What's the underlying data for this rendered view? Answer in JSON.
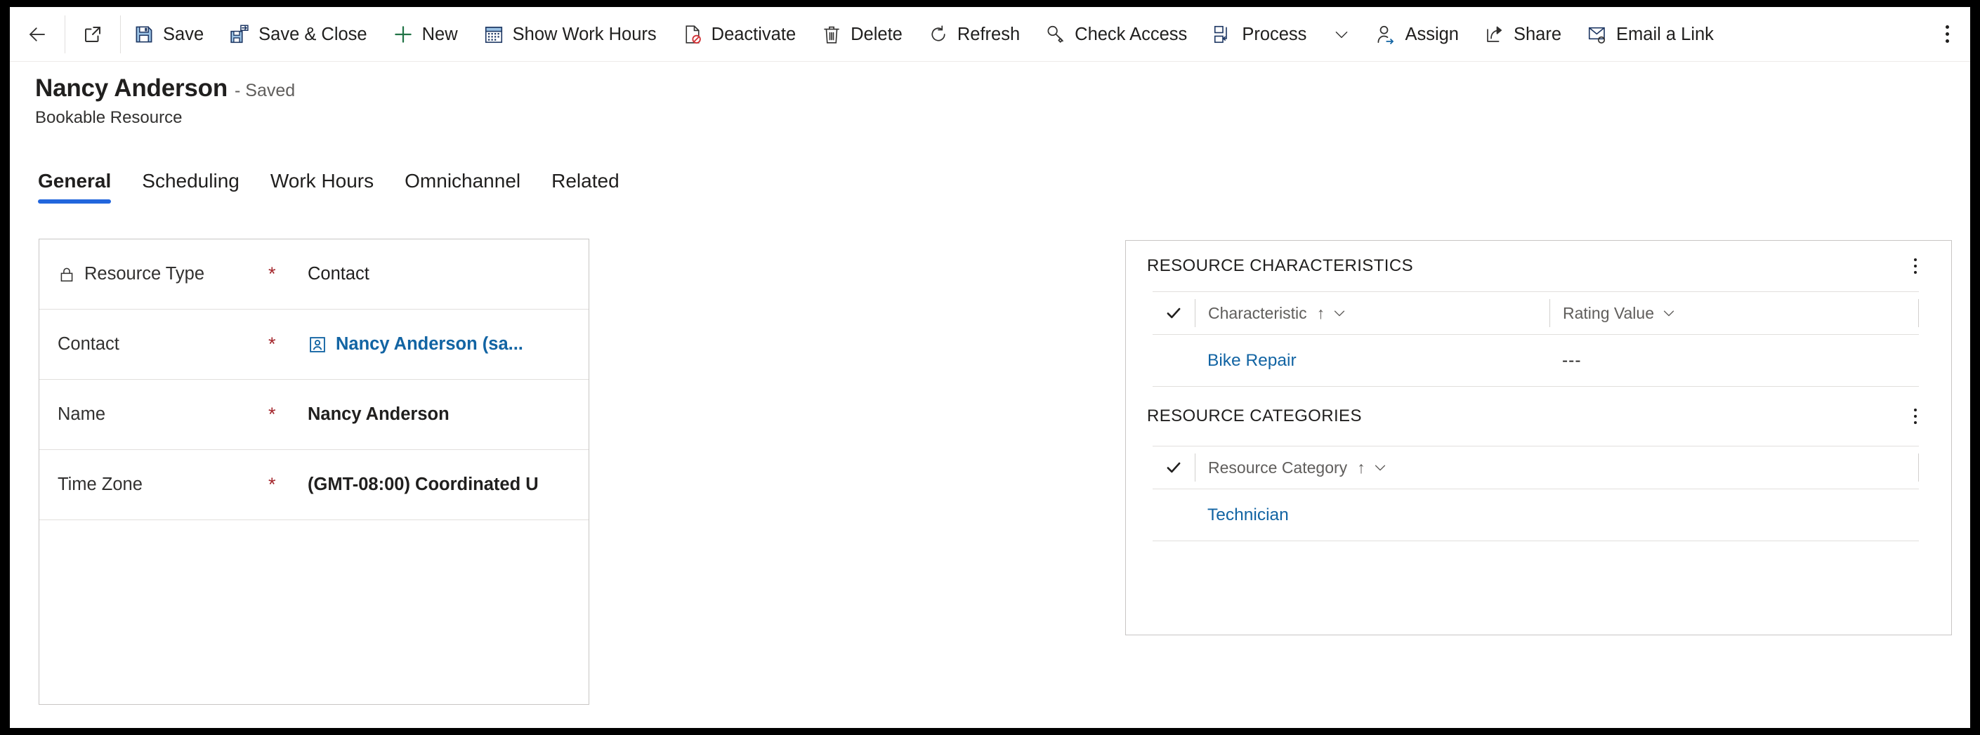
{
  "commandbar": {
    "back_label": "Back",
    "popout_label": "Open in new window",
    "items": [
      {
        "label": "Save",
        "icon": "save-icon"
      },
      {
        "label": "Save & Close",
        "icon": "save-and-close-icon"
      },
      {
        "label": "New",
        "icon": "plus-icon"
      },
      {
        "label": "Show Work Hours",
        "icon": "calendar-icon"
      },
      {
        "label": "Deactivate",
        "icon": "deactivate-icon"
      },
      {
        "label": "Delete",
        "icon": "trash-icon"
      },
      {
        "label": "Refresh",
        "icon": "refresh-icon"
      },
      {
        "label": "Check Access",
        "icon": "key-icon"
      },
      {
        "label": "Process",
        "icon": "process-icon"
      },
      {
        "label": "Assign",
        "icon": "assign-user-icon"
      },
      {
        "label": "Share",
        "icon": "share-icon"
      },
      {
        "label": "Email a Link",
        "icon": "email-link-icon"
      }
    ],
    "overflow_label": "More commands"
  },
  "header": {
    "title": "Nancy Anderson",
    "saved_state": "- Saved",
    "entity": "Bookable Resource"
  },
  "tabs": [
    {
      "label": "General",
      "active": true
    },
    {
      "label": "Scheduling",
      "active": false
    },
    {
      "label": "Work Hours",
      "active": false
    },
    {
      "label": "Omnichannel",
      "active": false
    },
    {
      "label": "Related",
      "active": false
    }
  ],
  "form": {
    "fields": [
      {
        "label": "Resource Type",
        "required": "*",
        "value": "Contact",
        "locked": true,
        "link": false,
        "bold": false
      },
      {
        "label": "Contact",
        "required": "*",
        "value": "Nancy Anderson (sa...",
        "locked": false,
        "link": true,
        "bold": true
      },
      {
        "label": "Name",
        "required": "*",
        "value": "Nancy Anderson",
        "locked": false,
        "link": false,
        "bold": true
      },
      {
        "label": "Time Zone",
        "required": "*",
        "value": "(GMT-08:00) Coordinated U",
        "locked": false,
        "link": false,
        "bold": true
      }
    ]
  },
  "panels": [
    {
      "title": "RESOURCE CHARACTERISTICS",
      "more_label": "More commands",
      "columns": [
        {
          "label": "Characteristic",
          "sorted": "↑"
        },
        {
          "label": "Rating Value",
          "sorted": ""
        }
      ],
      "rows": [
        {
          "cells": [
            "Bike Repair",
            "---"
          ]
        }
      ]
    },
    {
      "title": "RESOURCE CATEGORIES",
      "more_label": "More commands",
      "columns": [
        {
          "label": "Resource Category",
          "sorted": "↑"
        }
      ],
      "rows": [
        {
          "cells": [
            "Technician"
          ]
        }
      ]
    }
  ],
  "colors": {
    "accent": "#2266dd",
    "link": "#1264a3",
    "required": "#a4262c",
    "border": "#c8c6c4",
    "text": "#201f1e",
    "muted": "#605e5c"
  }
}
